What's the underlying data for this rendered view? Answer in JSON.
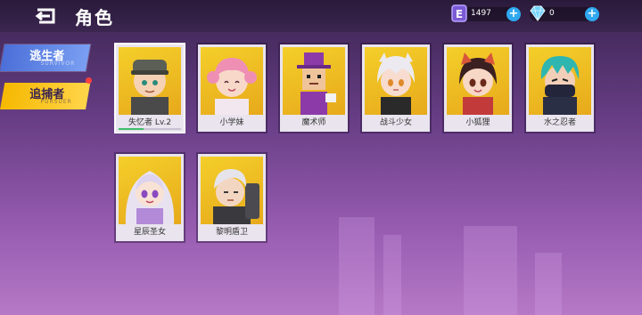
{
  "header": {
    "title": "角色"
  },
  "currency": [
    {
      "icon": "energy-crystal-icon",
      "value": "1497"
    },
    {
      "icon": "diamond-icon",
      "value": "0"
    }
  ],
  "tabs": [
    {
      "label": "逃生者",
      "sub": "SURVIVOR",
      "selected": false
    },
    {
      "label": "追捕者",
      "sub": "PURSUER",
      "selected": true,
      "has_notification": true
    }
  ],
  "characters": [
    {
      "name": "失忆者 Lv.2",
      "selected": true,
      "level_progress": 0.4
    },
    {
      "name": "小学妹"
    },
    {
      "name": "魔术师"
    },
    {
      "name": "战斗少女"
    },
    {
      "name": "小狐狸"
    },
    {
      "name": "水之忍者"
    },
    {
      "name": "星辰圣女"
    },
    {
      "name": "黎明盾卫"
    }
  ],
  "colors": {
    "accent_yellow": "#f6b800",
    "survivor_blue": "#4b6fd8",
    "plus_blue": "#2fa8f0"
  }
}
